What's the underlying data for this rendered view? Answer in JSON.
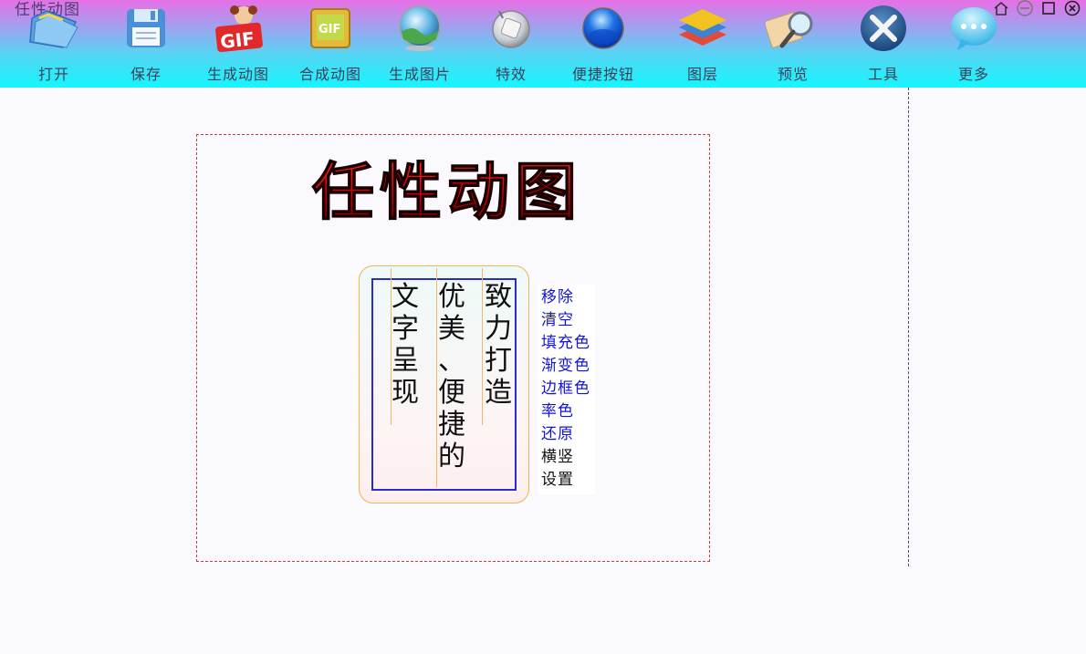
{
  "app": {
    "title": "任性动图"
  },
  "toolbar": {
    "items": [
      {
        "label": "打开",
        "icon": "folder-icon"
      },
      {
        "label": "保存",
        "icon": "floppy-disk-icon"
      },
      {
        "label": "生成动图",
        "icon": "gif-girl-icon"
      },
      {
        "label": "合成动图",
        "icon": "gif-frame-icon"
      },
      {
        "label": "生成图片",
        "icon": "landscape-ball-icon"
      },
      {
        "label": "特效",
        "icon": "effects-icon"
      },
      {
        "label": "便捷按钮",
        "icon": "blue-button-icon"
      },
      {
        "label": "图层",
        "icon": "layers-icon"
      },
      {
        "label": "预览",
        "icon": "magnifier-icon"
      },
      {
        "label": "工具",
        "icon": "tools-icon"
      },
      {
        "label": "更多",
        "icon": "chat-bubble-icon"
      }
    ]
  },
  "window_controls": [
    "home-icon",
    "minimize-icon",
    "maximize-icon",
    "close-icon"
  ],
  "canvas": {
    "logo_text": "任性动图",
    "poem_columns": [
      "致力打造",
      "优美、便捷的",
      "文字呈现"
    ]
  },
  "context_menu": {
    "items": [
      {
        "label": "移除",
        "color": "#1414d6"
      },
      {
        "label": "清空",
        "color": "#1414d6"
      },
      {
        "label": "填充色",
        "color": "#1414d6"
      },
      {
        "label": "渐变色",
        "color": "#1414d6"
      },
      {
        "label": "边框色",
        "color": "#1414d6"
      },
      {
        "label": "率色",
        "color": "#1414d6"
      },
      {
        "label": "还原",
        "color": "#1414d6"
      },
      {
        "label": "横竖",
        "color": "#111111"
      },
      {
        "label": "设置",
        "color": "#111111"
      }
    ]
  },
  "colors": {
    "toolbar_top": "#e76fe6",
    "toolbar_bottom": "#13f7fd",
    "logo_red": "#c40000",
    "menu_blue": "#1414d6"
  }
}
